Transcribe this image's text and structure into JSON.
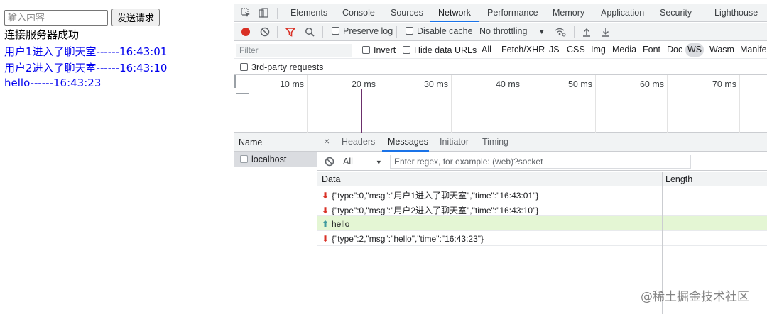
{
  "page": {
    "input_placeholder": "输入内容",
    "send_label": "发送请求",
    "status": "连接服务器成功",
    "messages": [
      "用户1进入了聊天室------16:43:01",
      "用户2进入了聊天室------16:43:10",
      "hello------16:43:23"
    ]
  },
  "devtools": {
    "tabs": [
      "Elements",
      "Console",
      "Sources",
      "Network",
      "Performance",
      "Memory",
      "Application",
      "Security",
      "Lighthouse"
    ],
    "active_tab": "Network",
    "toolbar": {
      "preserve_log": "Preserve log",
      "disable_cache": "Disable cache",
      "throttling": "No throttling"
    },
    "filter": {
      "placeholder": "Filter",
      "invert": "Invert",
      "hide_data_urls": "Hide data URLs",
      "types": [
        "All",
        "Fetch/XHR",
        "JS",
        "CSS",
        "Img",
        "Media",
        "Font",
        "Doc",
        "WS",
        "Wasm",
        "Manife"
      ],
      "active_type": "WS",
      "third_party": "3rd-party requests"
    },
    "timeline": {
      "ticks": [
        "10 ms",
        "20 ms",
        "30 ms",
        "40 ms",
        "50 ms",
        "60 ms",
        "70 ms"
      ]
    },
    "requests": {
      "name_header": "Name",
      "items": [
        "localhost"
      ]
    },
    "detail": {
      "close": "×",
      "tabs": [
        "Headers",
        "Messages",
        "Initiator",
        "Timing"
      ],
      "active_tab": "Messages",
      "message_filter_value": "All",
      "regex_placeholder": "Enter regex, for example: (web)?socket",
      "columns": [
        "Data",
        "Length"
      ],
      "rows": [
        {
          "direction": "received",
          "data": "{\"type\":0,\"msg\":\"用户1进入了聊天室\",\"time\":\"16:43:01\"}"
        },
        {
          "direction": "received",
          "data": "{\"type\":0,\"msg\":\"用户2进入了聊天室\",\"time\":\"16:43:10\"}"
        },
        {
          "direction": "sent",
          "data": "hello"
        },
        {
          "direction": "received",
          "data": "{\"type\":2,\"msg\":\"hello\",\"time\":\"16:43:23\"}"
        }
      ]
    }
  },
  "watermark": "@稀土掘金技术社区",
  "colors": {
    "accent": "#1a73e8",
    "received_arrow": "#d93025",
    "sent_arrow": "#3e9a9e",
    "sent_row_bg": "#e4f6d4",
    "link_text": "#0000ee"
  }
}
